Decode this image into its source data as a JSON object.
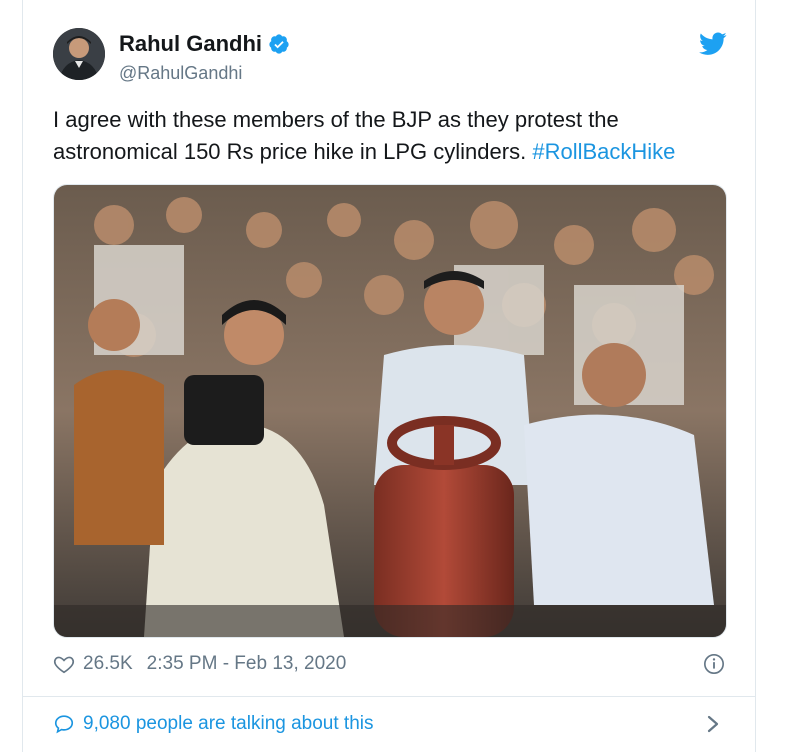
{
  "tweet": {
    "display_name": "Rahul Gandhi",
    "handle": "@RahulGandhi",
    "text": "I agree with these members of the BJP as they protest the astronomical 150 Rs price hike in LPG cylinders.",
    "hashtag": "#RollBackHike",
    "likes": "26.5K",
    "timestamp": "2:35 PM - Feb 13, 2020",
    "talking": "9,080 people are talking about this"
  },
  "icons": {
    "verified": "verified-badge-icon",
    "twitter": "twitter-bird-icon",
    "like": "heart-icon",
    "info": "info-icon",
    "reply": "speech-bubble-icon",
    "chevron": "chevron-right-icon"
  },
  "colors": {
    "link": "#1b95e0",
    "secondary_text": "#657786",
    "border": "#e1e8ed"
  }
}
